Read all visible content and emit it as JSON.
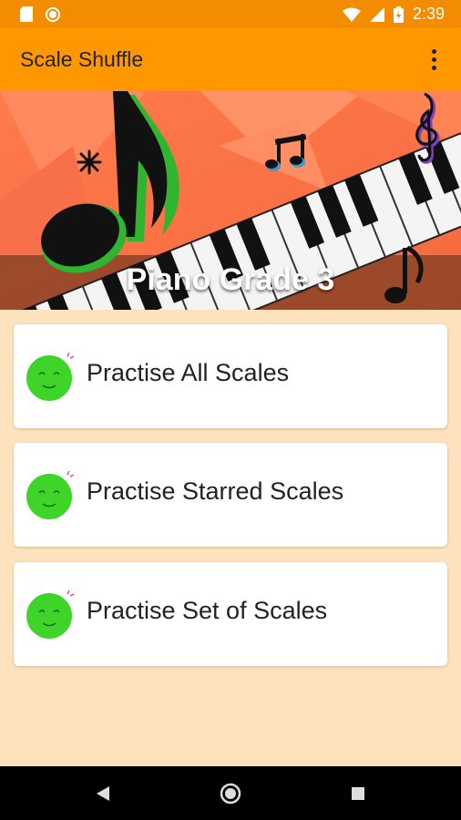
{
  "status": {
    "time": "2:39"
  },
  "app": {
    "title": "Scale Shuffle"
  },
  "banner": {
    "title": "Piano Grade 3"
  },
  "options": [
    {
      "label": "Practise All Scales"
    },
    {
      "label": "Practise Starred Scales"
    },
    {
      "label": "Practise Set of Scales"
    }
  ],
  "colors": {
    "accent": "#ff9800",
    "background": "#fde2bd",
    "face": "#3ed42a"
  },
  "icons": {
    "overflow": "more-vert-icon",
    "back": "back-icon",
    "home": "home-icon",
    "recents": "recents-icon"
  }
}
